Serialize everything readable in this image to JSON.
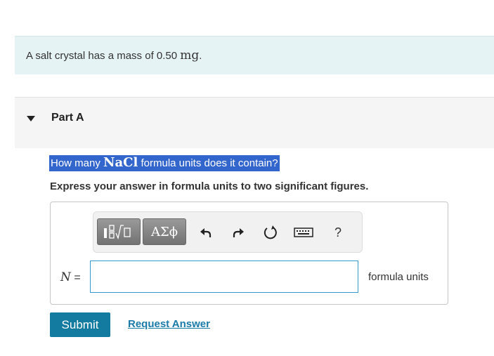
{
  "problem": {
    "text_before": "A salt crystal has a mass of 0.50 ",
    "unit": "mg",
    "text_after": "."
  },
  "part": {
    "title": "Part A"
  },
  "question": {
    "before": "How many ",
    "formula": "NaCl",
    "after": " formula units does it contain?"
  },
  "instruction": "Express your answer in formula units to two significant figures.",
  "toolbar": {
    "greek_label": "ΑΣϕ",
    "help_label": "?"
  },
  "answer": {
    "variable": "N",
    "equals": " =",
    "value": "",
    "placeholder": "",
    "units": "formula units"
  },
  "actions": {
    "submit_label": "Submit",
    "request_label": "Request Answer"
  },
  "colors": {
    "problem_bg": "#e6f3f4",
    "highlight": "#3366cc",
    "submit_bg": "#137aa0",
    "link": "#1a7aa8",
    "input_border": "#3399cc"
  }
}
